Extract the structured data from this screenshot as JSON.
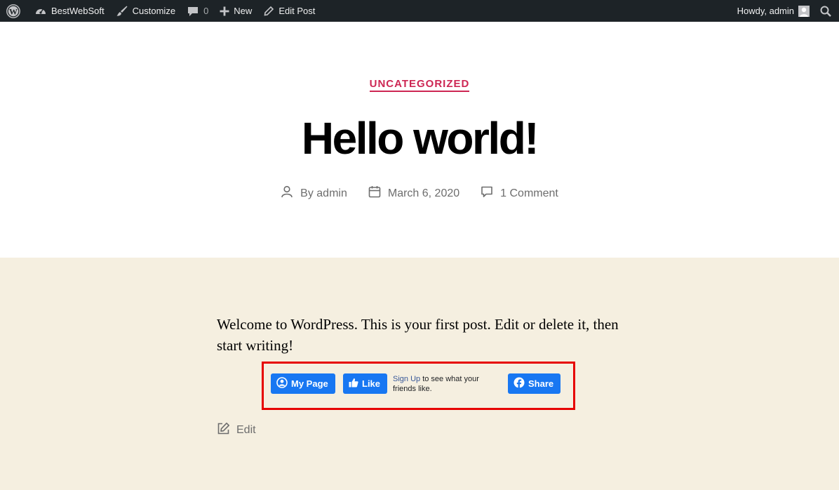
{
  "adminbar": {
    "wp_logo_icon": "wordpress-icon",
    "site_name": "BestWebSoft",
    "customize": "Customize",
    "comments_count": "0",
    "new": "New",
    "edit_post": "Edit Post",
    "howdy": "Howdy, admin"
  },
  "post": {
    "category": "UNCATEGORIZED",
    "title": "Hello world!",
    "author": "By admin",
    "date": "March 6, 2020",
    "comments": "1 Comment",
    "body": "Welcome to WordPress. This is your first post. Edit or delete it, then start writing!",
    "edit": "Edit"
  },
  "facebook": {
    "my_page": "My Page",
    "like": "Like",
    "sign_up": "Sign Up",
    "like_text": " to see what your friends like.",
    "share": "Share"
  },
  "colors": {
    "adminbar_bg": "#1d2327",
    "accent": "#cd2653",
    "content_bg": "#f5efe0",
    "facebook_blue": "#1877f2",
    "highlight_border": "#e60000"
  }
}
